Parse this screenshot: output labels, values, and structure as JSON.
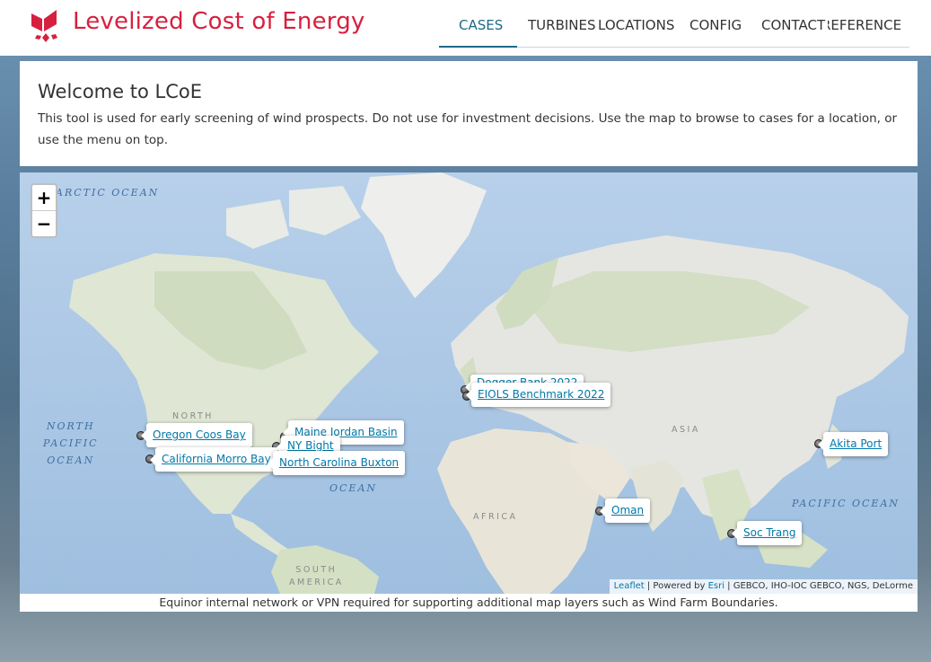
{
  "app": {
    "title": "Levelized Cost of Energy",
    "brand_color": "#d7203f",
    "accent_color": "#1f6a85"
  },
  "nav": {
    "items": [
      {
        "label": "CASES",
        "active": true
      },
      {
        "label": "TURBINES",
        "active": false
      },
      {
        "label": "LOCATIONS",
        "active": false
      },
      {
        "label": "CONFIG",
        "active": false
      },
      {
        "label": "CONTACT",
        "active": false
      },
      {
        "label": "REFERENCE",
        "active": false
      }
    ]
  },
  "welcome": {
    "heading": "Welcome to LCoE",
    "body": "This tool is used for early screening of wind prospects. Do not use for investment decisions. Use the map to browse to cases for a location, or use the menu on top."
  },
  "map": {
    "zoom_in_label": "+",
    "zoom_out_label": "−",
    "ocean_labels": {
      "arctic": "ARCTIC OCEAN",
      "north_pacific": "NORTH\nPACIFIC\nOCEAN",
      "atlantic": "OCEAN",
      "pacific_asia": "PACIFIC OCEAN"
    },
    "land_labels": {
      "north_america": "NORTH",
      "asia": "ASIA",
      "africa": "AFRICA",
      "south_america": "SOUTH\nAMERICA"
    },
    "cases": [
      {
        "label": "Oregon Coos Bay"
      },
      {
        "label": "California Morro Bay"
      },
      {
        "label": "Maine Jordan Basin"
      },
      {
        "label": "NY Bight"
      },
      {
        "label": "North Carolina Buxton"
      },
      {
        "label": "Dogger Bank 2022"
      },
      {
        "label": "EIOLS Benchmark 2022"
      },
      {
        "label": "Oman"
      },
      {
        "label": "Akita Port"
      },
      {
        "label": "Soc Trang"
      }
    ],
    "attribution": {
      "leaflet": "Leaflet",
      "powered_by": " | Powered by ",
      "esri": "Esri",
      "sources": " | GEBCO, IHO-IOC GEBCO, NGS, DeLorme"
    },
    "note": "Equinor internal network or VPN required for supporting additional map layers such as Wind Farm Boundaries."
  }
}
